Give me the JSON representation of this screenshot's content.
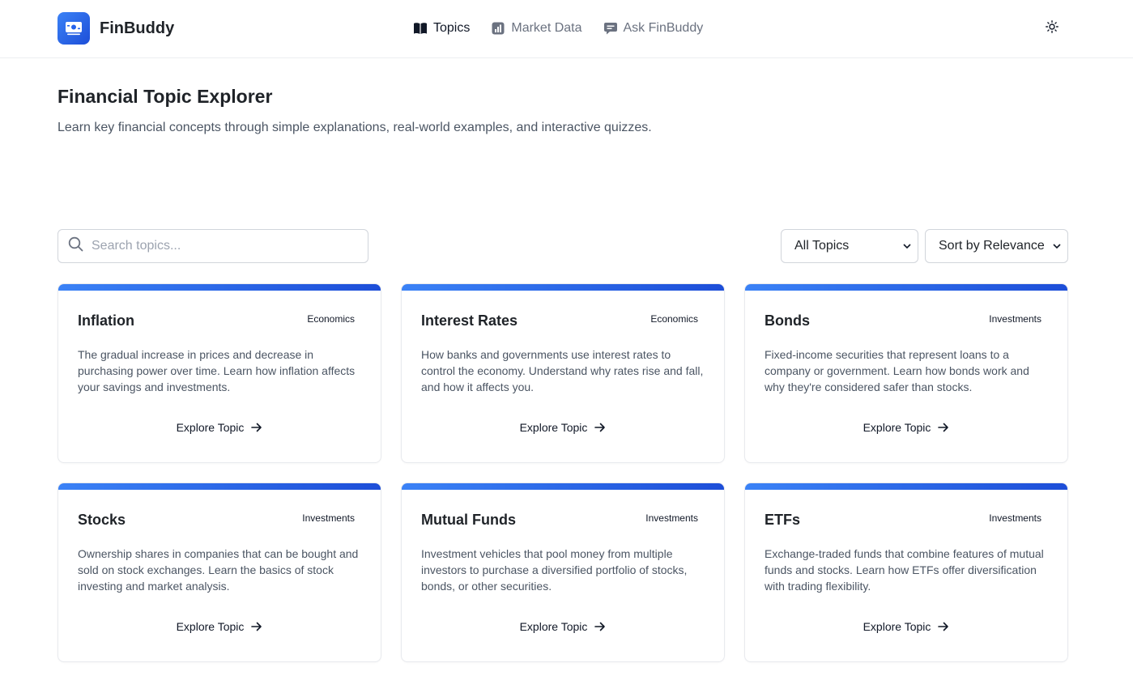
{
  "app": {
    "name": "FinBuddy",
    "accent": "#2563eb"
  },
  "nav": {
    "items": [
      {
        "label": "Topics",
        "icon": "book-icon",
        "active": true
      },
      {
        "label": "Market Data",
        "icon": "chart-icon",
        "active": false
      },
      {
        "label": "Ask FinBuddy",
        "icon": "chat-icon",
        "active": false
      }
    ],
    "theme_icon": "sun-icon"
  },
  "hero": {
    "title": "Financial Topic Explorer",
    "subtitle": "Learn key financial concepts through simple explanations, real-world examples, and interactive quizzes."
  },
  "controls": {
    "search_placeholder": "Search topics...",
    "category_selected": "All Topics",
    "sort_selected": "Sort by Relevance"
  },
  "cards": [
    {
      "title": "Inflation",
      "category": "Economics",
      "description": "The gradual increase in prices and decrease in purchasing power over time. Learn how inflation affects your savings and investments.",
      "link": "Explore Topic"
    },
    {
      "title": "Interest Rates",
      "category": "Economics",
      "description": "How banks and governments use interest rates to control the economy. Understand why rates rise and fall, and how it affects you.",
      "link": "Explore Topic"
    },
    {
      "title": "Bonds",
      "category": "Investments",
      "description": "Fixed-income securities that represent loans to a company or government. Learn how bonds work and why they're considered safer than stocks.",
      "link": "Explore Topic"
    },
    {
      "title": "Stocks",
      "category": "Investments",
      "description": "Ownership shares in companies that can be bought and sold on stock exchanges. Learn the basics of stock investing and market analysis.",
      "link": "Explore Topic"
    },
    {
      "title": "Mutual Funds",
      "category": "Investments",
      "description": "Investment vehicles that pool money from multiple investors to purchase a diversified portfolio of stocks, bonds, or other securities.",
      "link": "Explore Topic"
    },
    {
      "title": "ETFs",
      "category": "Investments",
      "description": "Exchange-traded funds that combine features of mutual funds and stocks. Learn how ETFs offer diversification with trading flexibility.",
      "link": "Explore Topic"
    }
  ]
}
